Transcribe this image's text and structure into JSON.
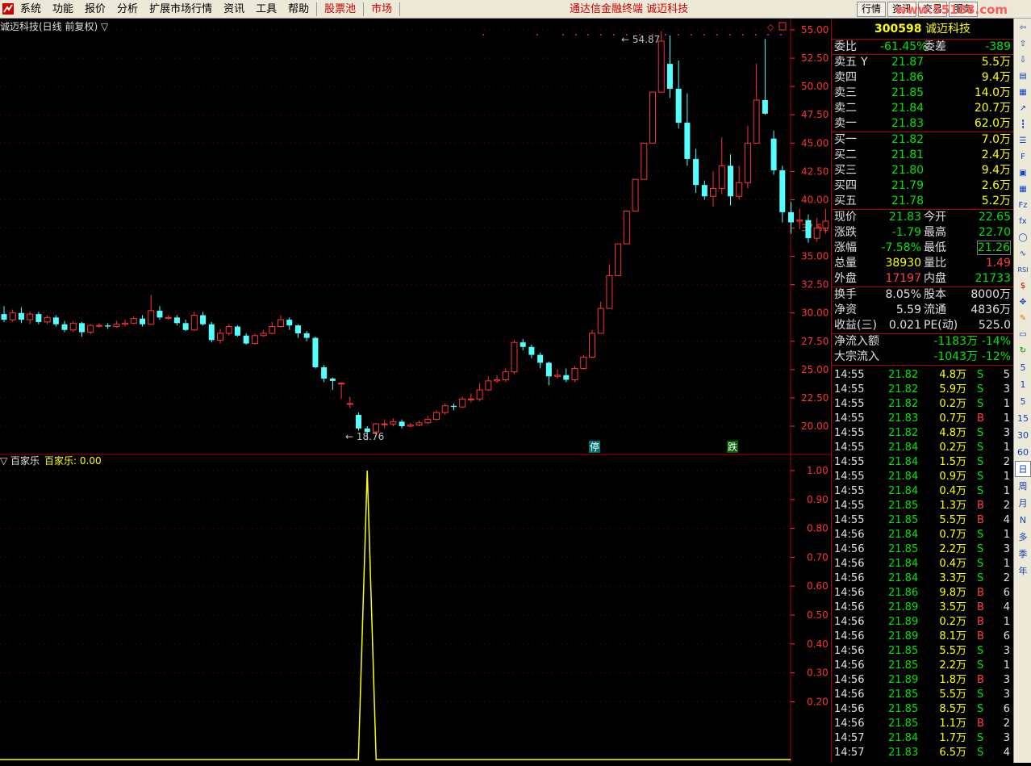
{
  "menu": {
    "items": [
      "系统",
      "功能",
      "报价",
      "分析",
      "扩展市场行情",
      "资讯",
      "工具",
      "帮助"
    ],
    "stock_pool": "股票池",
    "market": "市场"
  },
  "app_title": "通达信金融终端 诚迈科技",
  "top_buttons": [
    "行情",
    "资讯",
    "交易",
    "服务"
  ],
  "watermark": "www.55188.com",
  "chart": {
    "header": "诚迈科技(日线 前复权) ▽",
    "max_label": "54.87",
    "min_label": "18.76",
    "marker_a": "停",
    "marker_b": "跌",
    "price_axis": [
      "55.00",
      "52.50",
      "50.00",
      "47.50",
      "45.00",
      "42.50",
      "40.00",
      "37.50",
      "35.00",
      "32.50",
      "30.00",
      "27.50",
      "25.00",
      "22.50",
      "20.00"
    ],
    "indicator_header": "▽ 百家乐",
    "indicator_value": "百家乐: 0.00",
    "indicator_axis": [
      "1.00",
      "0.90",
      "0.80",
      "0.70",
      "0.60",
      "0.50",
      "0.40",
      "0.30",
      "0.20"
    ],
    "colors": {
      "up": "#ff3333",
      "down": "#54ffff",
      "grid": "#8b0000",
      "axis": "#ff3333",
      "line": "#ffff00"
    }
  },
  "chart_data": [
    {
      "type": "candlestick",
      "title": "诚迈科技(日线 前复权)",
      "ylim": [
        18,
        56
      ],
      "candles": [
        [
          29.9,
          29.4,
          30.6,
          29.2
        ],
        [
          29.4,
          30.0,
          30.3,
          29.2
        ],
        [
          30.0,
          29.4,
          30.5,
          29.1
        ],
        [
          29.4,
          29.9,
          30.1,
          29.0
        ],
        [
          29.9,
          29.2,
          30.1,
          29.0
        ],
        [
          29.2,
          29.6,
          29.8,
          29.0
        ],
        [
          29.6,
          29.0,
          29.8,
          28.8
        ],
        [
          29.0,
          28.5,
          29.3,
          28.3
        ],
        [
          28.5,
          29.1,
          29.3,
          28.3
        ],
        [
          29.1,
          28.3,
          29.2,
          27.9
        ],
        [
          28.3,
          28.9,
          29.0,
          28.1
        ],
        [
          28.9,
          28.9,
          29.1,
          28.7
        ],
        [
          28.9,
          28.8,
          29.1,
          28.6
        ],
        [
          28.8,
          29.0,
          29.3,
          28.7
        ],
        [
          29.0,
          29.1,
          29.4,
          28.8
        ],
        [
          29.1,
          29.5,
          29.7,
          29.0
        ],
        [
          29.5,
          29.0,
          29.8,
          28.8
        ],
        [
          29.0,
          30.2,
          31.6,
          29.0
        ],
        [
          30.2,
          29.6,
          30.6,
          29.4
        ],
        [
          29.6,
          29.6,
          29.8,
          29.4
        ],
        [
          29.6,
          29.1,
          29.8,
          28.9
        ],
        [
          29.1,
          28.5,
          29.4,
          28.4
        ],
        [
          28.5,
          29.8,
          30.1,
          28.4
        ],
        [
          29.8,
          29.0,
          30.1,
          28.9
        ],
        [
          29.0,
          27.6,
          29.2,
          27.4
        ],
        [
          27.6,
          28.2,
          28.6,
          27.3
        ],
        [
          28.2,
          28.8,
          29.0,
          28.0
        ],
        [
          28.8,
          28.0,
          28.9,
          27.9
        ],
        [
          28.0,
          27.3,
          28.2,
          27.2
        ],
        [
          27.3,
          28.0,
          28.2,
          27.2
        ],
        [
          28.0,
          28.2,
          28.5,
          27.9
        ],
        [
          28.2,
          28.8,
          29.2,
          28.1
        ],
        [
          28.8,
          29.4,
          29.8,
          28.7
        ],
        [
          29.4,
          28.9,
          29.6,
          28.5
        ],
        [
          28.9,
          28.2,
          29.0,
          27.8
        ],
        [
          28.2,
          27.8,
          28.4,
          27.5
        ],
        [
          27.8,
          25.2,
          27.9,
          25.1
        ],
        [
          25.2,
          24.2,
          25.4,
          23.9
        ],
        [
          24.2,
          24.0,
          24.3,
          23.2
        ],
        [
          23.8,
          23.8,
          23.9,
          22.4
        ],
        [
          22.0,
          22.0,
          22.6,
          21.6
        ],
        [
          21.0,
          19.8,
          21.2,
          19.6
        ],
        [
          19.8,
          19.5,
          20.0,
          18.76
        ],
        [
          19.5,
          20.2,
          20.3,
          19.1
        ],
        [
          20.2,
          20.2,
          20.6,
          19.8
        ],
        [
          20.2,
          20.4,
          20.7,
          20.0
        ],
        [
          20.4,
          20.0,
          20.6,
          19.8
        ],
        [
          20.0,
          20.1,
          20.3,
          19.9
        ],
        [
          20.1,
          20.3,
          20.5,
          20.0
        ],
        [
          20.3,
          20.6,
          20.9,
          20.2
        ],
        [
          20.6,
          21.2,
          21.4,
          20.5
        ],
        [
          21.2,
          21.8,
          22.0,
          21.0
        ],
        [
          21.8,
          21.7,
          22.0,
          21.4
        ],
        [
          21.7,
          22.4,
          22.6,
          21.6
        ],
        [
          22.4,
          22.4,
          22.9,
          22.1
        ],
        [
          22.4,
          23.2,
          23.8,
          22.2
        ],
        [
          23.2,
          24.0,
          24.4,
          23.1
        ],
        [
          24.0,
          24.1,
          24.5,
          23.8
        ],
        [
          24.1,
          24.8,
          25.1,
          23.9
        ],
        [
          24.8,
          27.4,
          27.6,
          24.6
        ],
        [
          27.4,
          27.0,
          27.7,
          26.7
        ],
        [
          27.0,
          26.3,
          27.2,
          26.0
        ],
        [
          26.3,
          25.6,
          26.5,
          25.1
        ],
        [
          25.6,
          24.4,
          25.7,
          23.6
        ],
        [
          24.4,
          24.5,
          25.0,
          24.2
        ],
        [
          24.5,
          24.1,
          25.1,
          23.9
        ],
        [
          24.1,
          25.1,
          25.3,
          23.9
        ],
        [
          25.1,
          26.1,
          26.3,
          25.0
        ],
        [
          26.1,
          28.2,
          28.5,
          26.0
        ],
        [
          28.2,
          30.4,
          31.0,
          28.2
        ],
        [
          30.4,
          33.3,
          34.3,
          30.4
        ],
        [
          33.3,
          36.1,
          36.1,
          33.3
        ],
        [
          36.1,
          39.0,
          39.0,
          39.0
        ],
        [
          39.0,
          41.8,
          41.8,
          41.8
        ],
        [
          41.8,
          45.0,
          45.0,
          45.0
        ],
        [
          45.0,
          49.5,
          49.5,
          49.5
        ],
        [
          49.5,
          54.0,
          54.87,
          49.5
        ],
        [
          52.0,
          49.8,
          54.5,
          49.0
        ],
        [
          49.8,
          46.8,
          52.3,
          46.3
        ],
        [
          46.8,
          43.6,
          49.4,
          43.0
        ],
        [
          43.6,
          41.3,
          44.5,
          40.6
        ],
        [
          41.3,
          40.3,
          41.7,
          40.0
        ],
        [
          40.3,
          41.0,
          42.5,
          39.4
        ],
        [
          41.0,
          43.0,
          45.5,
          40.5
        ],
        [
          43.0,
          40.3,
          44.0,
          39.5
        ],
        [
          40.3,
          41.5,
          43.0,
          40.0
        ],
        [
          41.5,
          45.0,
          46.5,
          41.0
        ],
        [
          45.0,
          48.8,
          52.0,
          45.0
        ],
        [
          48.8,
          47.6,
          54.2,
          47.5
        ],
        [
          45.4,
          42.6,
          46.1,
          42.2
        ],
        [
          42.6,
          38.9,
          43.0,
          38.0
        ],
        [
          38.9,
          38.0,
          39.8,
          37.0
        ],
        [
          38.1,
          38.2,
          39.2,
          37.4
        ],
        [
          38.2,
          36.6,
          38.7,
          36.2
        ],
        [
          36.6,
          37.5,
          38.4,
          36.3
        ],
        [
          37.5,
          38.1,
          39.2,
          37.0
        ],
        [
          38.1,
          38.9,
          39.4,
          37.6
        ],
        [
          38.9,
          38.3,
          39.4,
          37.9
        ]
      ]
    },
    {
      "type": "line",
      "title": "百家乐",
      "series": [
        {
          "name": "百家乐",
          "value": "0.00"
        }
      ],
      "ylim": [
        0,
        1.0
      ]
    }
  ],
  "quote": {
    "code": "300598",
    "name": "诚迈科技",
    "weibi": {
      "l1": "委比",
      "v1": "-61.45%",
      "l2": "委差",
      "v2": "-389"
    },
    "asks": [
      {
        "label": "卖五",
        "sym": "Y",
        "price": "21.87",
        "vol": "5.5万"
      },
      {
        "label": "卖四",
        "sym": "",
        "price": "21.86",
        "vol": "9.4万"
      },
      {
        "label": "卖三",
        "sym": "",
        "price": "21.85",
        "vol": "14.0万"
      },
      {
        "label": "卖二",
        "sym": "",
        "price": "21.84",
        "vol": "20.7万"
      },
      {
        "label": "卖一",
        "sym": "",
        "price": "21.83",
        "vol": "62.0万"
      }
    ],
    "bids": [
      {
        "label": "买一",
        "price": "21.82",
        "vol": "7.0万"
      },
      {
        "label": "买二",
        "price": "21.81",
        "vol": "2.4万"
      },
      {
        "label": "买三",
        "price": "21.80",
        "vol": "9.4万"
      },
      {
        "label": "买四",
        "price": "21.79",
        "vol": "2.6万"
      },
      {
        "label": "买五",
        "price": "21.78",
        "vol": "5.2万"
      }
    ],
    "stats": [
      {
        "l1": "现价",
        "v1": "21.83",
        "c1": "g",
        "l2": "今开",
        "v2": "22.65",
        "c2": "g"
      },
      {
        "l1": "涨跌",
        "v1": "-1.79",
        "c1": "g",
        "l2": "最高",
        "v2": "22.70",
        "c2": "g"
      },
      {
        "l1": "涨幅",
        "v1": "-7.58%",
        "c1": "g",
        "l2": "最低",
        "v2": "21.26",
        "c2": "g"
      },
      {
        "l1": "总量",
        "v1": "38930",
        "c1": "y",
        "l2": "量比",
        "v2": "1.49",
        "c2": "r"
      },
      {
        "l1": "外盘",
        "v1": "17197",
        "c1": "r",
        "l2": "内盘",
        "v2": "21733",
        "c2": "g"
      }
    ],
    "info": [
      {
        "l1": "换手",
        "v1": "8.05%",
        "l2": "股本",
        "v2": "8000万"
      },
      {
        "l1": "净资",
        "v1": "5.59",
        "l2": "流通",
        "v2": "4836万"
      },
      {
        "l1": "收益(三)",
        "v1": "0.021",
        "l2": "PE(动)",
        "v2": "525.0"
      }
    ],
    "flow": [
      {
        "label": "净流入额",
        "val": "-1183万",
        "pct": "-14%"
      },
      {
        "label": "大宗流入",
        "val": "-1043万",
        "pct": "-12%"
      }
    ],
    "ticks": [
      [
        "14:55",
        "21.82",
        "4.8万",
        "S",
        "5"
      ],
      [
        "14:55",
        "21.82",
        "5.9万",
        "S",
        "3"
      ],
      [
        "14:55",
        "21.82",
        "0.2万",
        "S",
        "1"
      ],
      [
        "14:55",
        "21.83",
        "0.7万",
        "B",
        "1"
      ],
      [
        "14:55",
        "21.82",
        "4.8万",
        "S",
        "3"
      ],
      [
        "14:55",
        "21.84",
        "0.2万",
        "S",
        "1"
      ],
      [
        "14:55",
        "21.84",
        "1.5万",
        "S",
        "2"
      ],
      [
        "14:55",
        "21.84",
        "0.9万",
        "S",
        "1"
      ],
      [
        "14:55",
        "21.84",
        "0.4万",
        "S",
        "1"
      ],
      [
        "14:55",
        "21.85",
        "1.3万",
        "B",
        "2"
      ],
      [
        "14:55",
        "21.85",
        "5.5万",
        "B",
        "4"
      ],
      [
        "14:56",
        "21.84",
        "0.7万",
        "S",
        "1"
      ],
      [
        "14:56",
        "21.85",
        "2.2万",
        "S",
        "3"
      ],
      [
        "14:56",
        "21.84",
        "0.4万",
        "S",
        "1"
      ],
      [
        "14:56",
        "21.84",
        "3.3万",
        "S",
        "2"
      ],
      [
        "14:56",
        "21.86",
        "9.8万",
        "B",
        "6"
      ],
      [
        "14:56",
        "21.89",
        "3.5万",
        "B",
        "4"
      ],
      [
        "14:56",
        "21.89",
        "0.2万",
        "B",
        "1"
      ],
      [
        "14:56",
        "21.89",
        "8.1万",
        "B",
        "6"
      ],
      [
        "14:56",
        "21.85",
        "5.5万",
        "S",
        "3"
      ],
      [
        "14:56",
        "21.85",
        "2.2万",
        "S",
        "1"
      ],
      [
        "14:56",
        "21.89",
        "1.8万",
        "B",
        "3"
      ],
      [
        "14:56",
        "21.85",
        "5.5万",
        "S",
        "3"
      ],
      [
        "14:56",
        "21.85",
        "8.5万",
        "S",
        "6"
      ],
      [
        "14:56",
        "21.85",
        "1.1万",
        "B",
        "2"
      ],
      [
        "14:57",
        "21.84",
        "1.7万",
        "S",
        "3"
      ],
      [
        "14:57",
        "21.83",
        "6.5万",
        "S",
        "4"
      ]
    ]
  },
  "tools": [
    "5",
    "1",
    "5",
    "15",
    "30",
    "60",
    "日",
    "周",
    "月",
    "N",
    "多",
    "季",
    "年"
  ]
}
